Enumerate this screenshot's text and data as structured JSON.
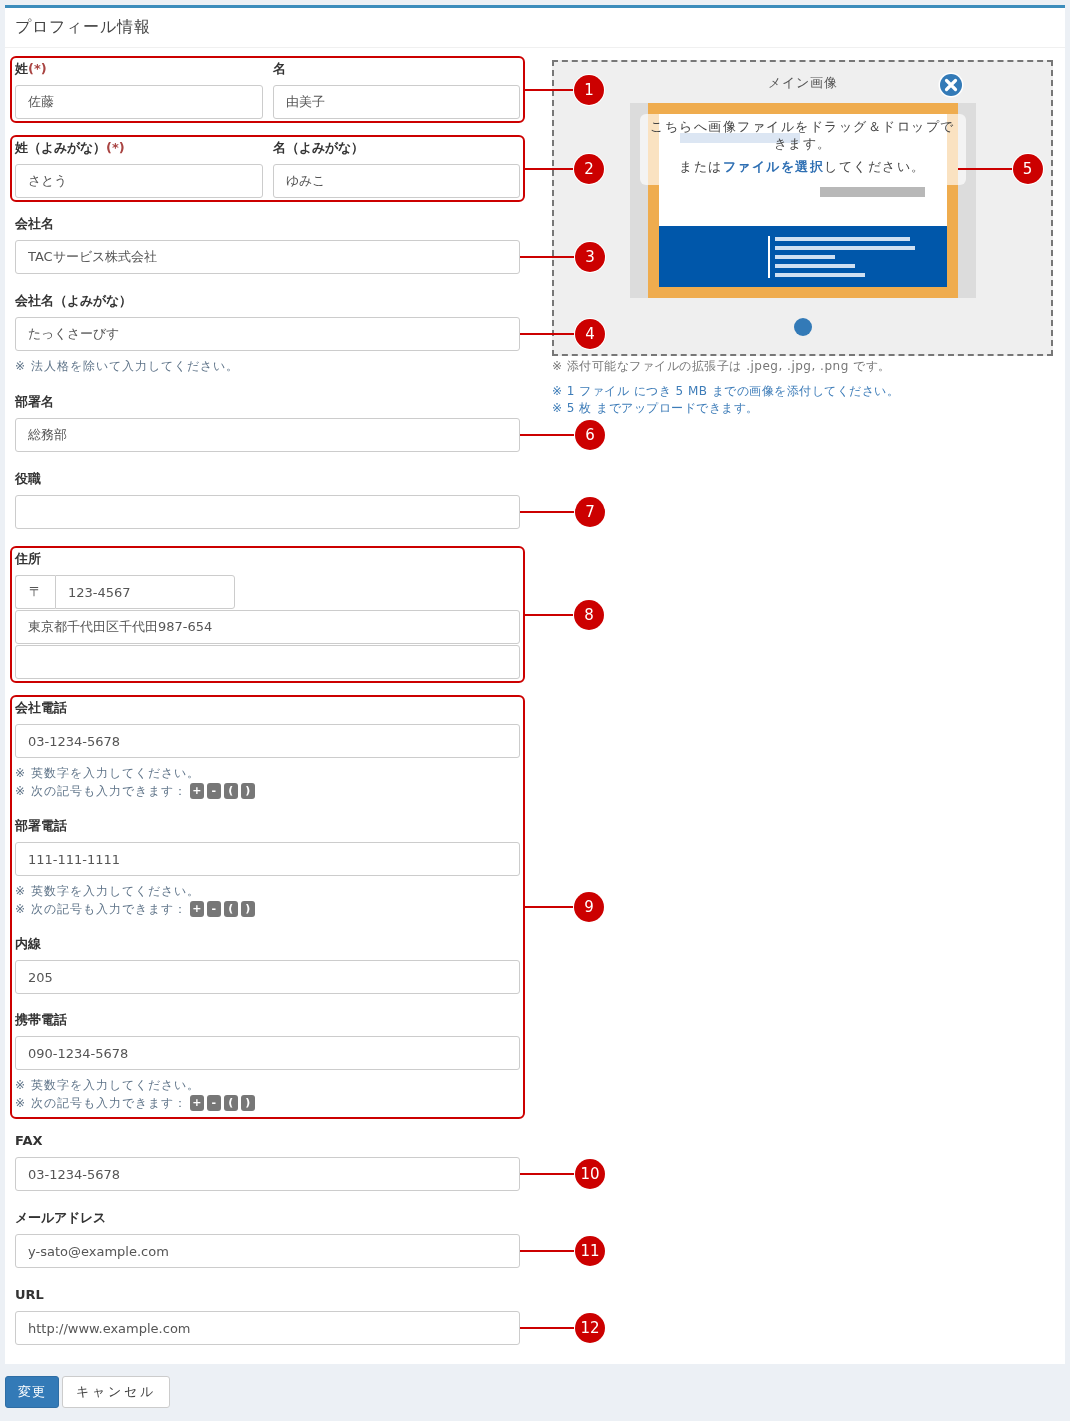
{
  "header": {
    "title": "プロフィール情報"
  },
  "sections": [
    {
      "callout": "1",
      "boxed": true,
      "fields": [
        {
          "kind": "pair",
          "items": [
            {
              "label": "姓",
              "required_mark": "(*)",
              "value": "佐藤"
            },
            {
              "label": "名",
              "value": "由美子"
            }
          ]
        }
      ]
    },
    {
      "callout": "2",
      "boxed": true,
      "fields": [
        {
          "kind": "pair",
          "items": [
            {
              "label": "姓（よみがな）",
              "required_mark": "(*)",
              "value": "さとう"
            },
            {
              "label": "名（よみがな）",
              "value": "ゆみこ"
            }
          ]
        }
      ]
    },
    {
      "callout": "3",
      "boxed": false,
      "fields": [
        {
          "kind": "text",
          "label": "会社名",
          "value": "TACサービス株式会社"
        }
      ]
    },
    {
      "callout": "4",
      "boxed": false,
      "fields": [
        {
          "kind": "text",
          "label": "会社名（よみがな）",
          "value": "たっくさーびす",
          "hints": [
            "※ 法人格を除いて入力してください。"
          ]
        }
      ]
    },
    {
      "callout": "6",
      "boxed": false,
      "fields": [
        {
          "kind": "text",
          "label": "部署名",
          "value": "総務部"
        }
      ]
    },
    {
      "callout": "7",
      "boxed": false,
      "fields": [
        {
          "kind": "text",
          "label": "役職"
        }
      ]
    },
    {
      "callout": "8",
      "boxed": true,
      "fields": [
        {
          "kind": "address",
          "label": "住所",
          "postal_mark": "〒",
          "postal_code": "123-4567",
          "lines": [
            {
              "kind": "field",
              "value": "東京都千代田区千代田987-654"
            },
            {
              "kind": "field"
            }
          ]
        }
      ]
    },
    {
      "callout": "9",
      "boxed": true,
      "fields": [
        {
          "kind": "phone",
          "label": "会社電話",
          "value": "03-1234-5678",
          "hints": [
            "※ 英数字を入力してください。"
          ],
          "symbols_hint": "※ 次の記号も入力できます：",
          "symbols": [
            "+",
            "-",
            "(",
            ")"
          ]
        },
        {
          "kind": "phone",
          "label": "部署電話",
          "value": "111-111-1111",
          "hints": [
            "※ 英数字を入力してください。"
          ],
          "symbols_hint": "※ 次の記号も入力できます：",
          "symbols": [
            "+",
            "-",
            "(",
            ")"
          ]
        },
        {
          "kind": "text",
          "label": "内線",
          "value": "205"
        },
        {
          "kind": "phone",
          "label": "携帯電話",
          "value": "090-1234-5678",
          "hints": [
            "※ 英数字を入力してください。"
          ],
          "symbols_hint": "※ 次の記号も入力できます：",
          "symbols": [
            "+",
            "-",
            "(",
            ")"
          ]
        }
      ]
    },
    {
      "callout": "10",
      "boxed": false,
      "fields": [
        {
          "kind": "text",
          "label": "FAX",
          "value": "03-1234-5678"
        }
      ]
    },
    {
      "callout": "11",
      "boxed": false,
      "fields": [
        {
          "kind": "text",
          "label": "メールアドレス",
          "value": "y-sato@example.com"
        }
      ]
    },
    {
      "callout": "12",
      "boxed": false,
      "fields": [
        {
          "kind": "text",
          "label": "URL",
          "value": "http://www.example.com"
        }
      ]
    }
  ],
  "uploader": {
    "title": "メイン画像",
    "callout": "5",
    "drop_text": "こちらへ画像ファイルをドラッグ＆ドロップできます。",
    "select_prefix": "または",
    "select_link": "ファイルを選択",
    "select_suffix": "してください。",
    "pages": [
      {
        "selected": true
      }
    ],
    "notes": [
      {
        "text": "※ 添付可能なファイルの拡張子は .jpeg, .jpg, .png です。",
        "emphasis": false
      },
      {
        "text": "※ 1 ファイル につき 5 MB までの画像を添付してください。",
        "emphasis": true
      },
      {
        "text": "※ 5 枚 までアップロードできます。",
        "emphasis": true
      }
    ]
  },
  "actions": [
    {
      "label": "変更",
      "primary": true
    },
    {
      "label": "キャンセル",
      "primary": false
    }
  ]
}
